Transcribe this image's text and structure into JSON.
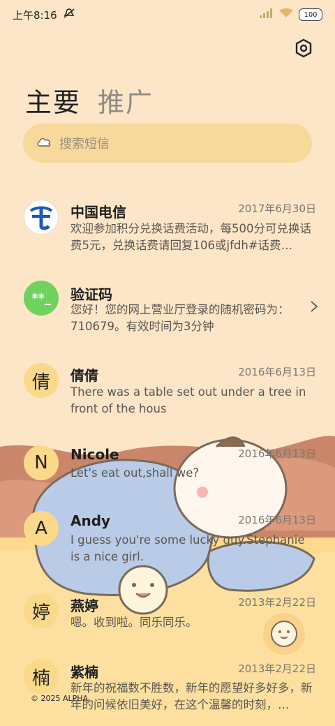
{
  "status_bar": {
    "time": "上午8:16",
    "battery": "100"
  },
  "tabs": [
    {
      "label": "主要",
      "active": true
    },
    {
      "label": "推广",
      "active": false
    }
  ],
  "search": {
    "placeholder": "搜索短信"
  },
  "conversations": [
    {
      "name": "中国电信",
      "date": "2017年6月30日",
      "preview": "欢迎参加积分兑换话费活动，每500分可兑换话费5元，兑换话费请回复106或jfdh#话费…",
      "avatar_icon": "china-telecom-logo"
    },
    {
      "name": "验证码",
      "date": "",
      "preview": "您好！您的网上营业厅登录的随机密码为：710679。有效时间为3分钟",
      "avatar_text": "**_",
      "avatar_color": "#6fd25e"
    },
    {
      "name": "倩倩",
      "date": "2016年6月13日",
      "preview": "There was a table set out under a tree in front of the hous",
      "avatar_text": "倩"
    },
    {
      "name": "Nicole",
      "date": "2016年6月13日",
      "preview": "Let's eat out,shall we?",
      "avatar_text": "N"
    },
    {
      "name": "Andy",
      "date": "2016年6月13日",
      "preview": "I guess you're some lucky guy.Stephanie is a nice girl.",
      "avatar_text": "A"
    },
    {
      "name": "燕婷",
      "date": "2013年2月22日",
      "preview": "嗯。收到啦。同乐同乐。",
      "avatar_text": "婷"
    },
    {
      "name": "紫楠",
      "date": "2013年2月22日",
      "preview": "新年的祝福数不胜数，新年的愿望好多好多，新年的问候依旧美好，在这个温馨的时刻，…",
      "avatar_text": "楠"
    }
  ],
  "footer": {
    "copyright": "© 2025 ALPHA"
  },
  "colors": {
    "background": "#fde6c8",
    "search_bg": "#f7d99c",
    "avatar_bg": "#fbd98a",
    "telecom_blue": "#1a5bb5"
  }
}
